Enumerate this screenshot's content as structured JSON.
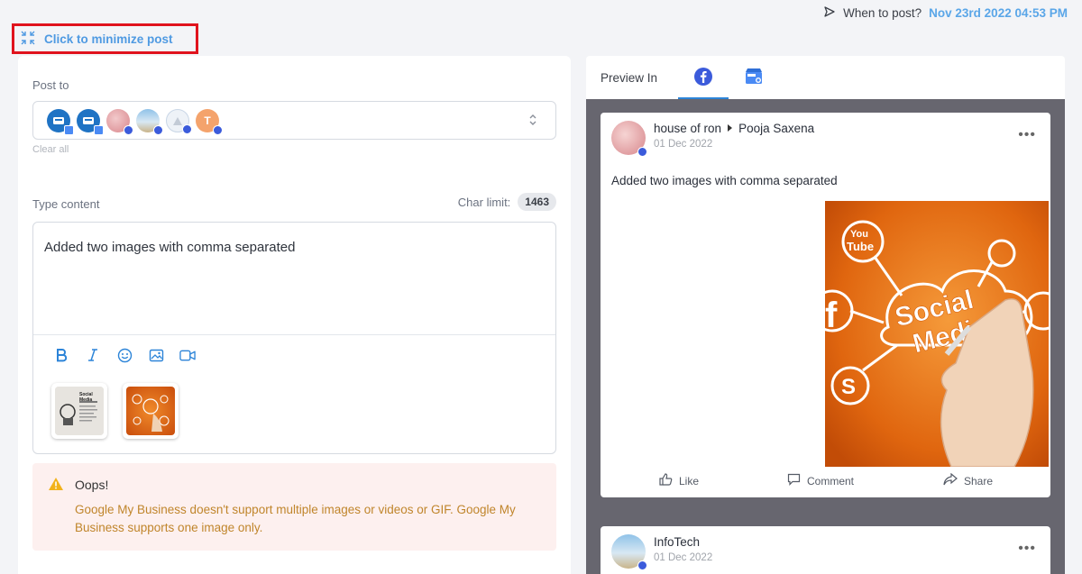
{
  "header": {
    "when_label": "When to post?",
    "when_date": "Nov 23rd 2022 04:53 PM",
    "minimize_label": "Click to minimize post"
  },
  "composer": {
    "post_to_label": "Post to",
    "clear_all": "Clear all",
    "type_content_label": "Type content",
    "char_limit_label": "Char limit:",
    "char_limit_value": "1463",
    "content_text": "Added two images with comma separated",
    "accounts": [
      {
        "initial": "",
        "color": "#1f73c4",
        "network": "gmb"
      },
      {
        "initial": "",
        "color": "#1f73c4",
        "network": "gmb"
      },
      {
        "initial": "",
        "color": "#e7a4a8",
        "network": "facebook"
      },
      {
        "initial": "",
        "color": "#9cc3e0",
        "network": "facebook"
      },
      {
        "initial": "",
        "color": "#c9d6e6",
        "network": "facebook"
      },
      {
        "initial": "T",
        "color": "#f4a36c",
        "network": "facebook"
      }
    ],
    "toolbar": [
      "bold-icon",
      "italic-icon",
      "emoji-icon",
      "image-icon",
      "video-icon"
    ],
    "thumbnails": [
      {
        "title": "Social Media",
        "kind": "document"
      },
      {
        "title": "",
        "kind": "orange-photo"
      }
    ]
  },
  "warning": {
    "title": "Oops!",
    "message": "Google My Business doesn't support multiple images or videos or GIF. Google My Business supports one image only."
  },
  "preview": {
    "label": "Preview In",
    "tabs": [
      "facebook",
      "google-my-business"
    ],
    "active_tab": "facebook",
    "posts": [
      {
        "page": "house of ron",
        "author": "Pooja Saxena",
        "date": "01 Dec 2022",
        "content": "Added two images with comma separated",
        "image_words": [
          "Social",
          "Media"
        ],
        "actions": [
          "Like",
          "Comment",
          "Share"
        ]
      },
      {
        "page": "InfoTech",
        "date": "01 Dec 2022"
      }
    ]
  },
  "colors": {
    "accent": "#2c84d8",
    "warning_bg": "#fdf0ef",
    "warning_text": "#c0852b",
    "highlight_border": "#e0131d",
    "preview_bg": "#67666f"
  }
}
